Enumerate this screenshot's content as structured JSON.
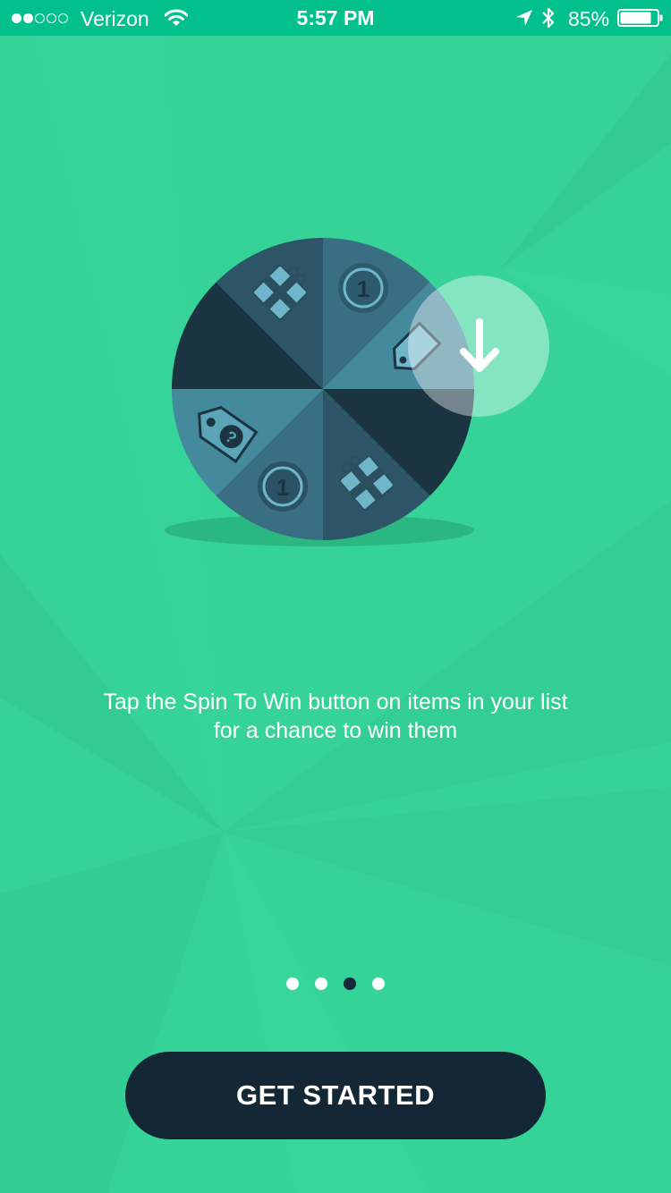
{
  "status_bar": {
    "signal_bars": [
      true,
      true,
      false,
      false,
      false
    ],
    "carrier": "Verizon",
    "time": "5:57 PM",
    "battery_percent": "85%",
    "battery_level": 0.85,
    "icons": [
      "wifi-icon",
      "location-arrow-icon",
      "bluetooth-icon",
      "battery-icon"
    ]
  },
  "onboarding": {
    "illustration": {
      "name": "spin-to-win-wheel",
      "slice_icons": [
        "gift-icon",
        "coin-icon",
        "price-tag-icon",
        "gift-icon",
        "coin-icon",
        "price-tag-icon"
      ],
      "coin_label": "1",
      "tag_label": "?",
      "overlay_icon": "down-arrow-icon"
    },
    "description": "Tap the Spin To Win button on items in your list for a chance to win them",
    "pager": {
      "total": 4,
      "active_index": 2
    },
    "cta_label": "GET STARTED"
  },
  "colors": {
    "background": "#35d398",
    "status_bar": "#02c08c",
    "button": "#132734",
    "active_dot": "#15293a",
    "wheel_dark": "#1a3441",
    "wheel_mid": "#2d5467",
    "wheel_light": "#45899d"
  }
}
